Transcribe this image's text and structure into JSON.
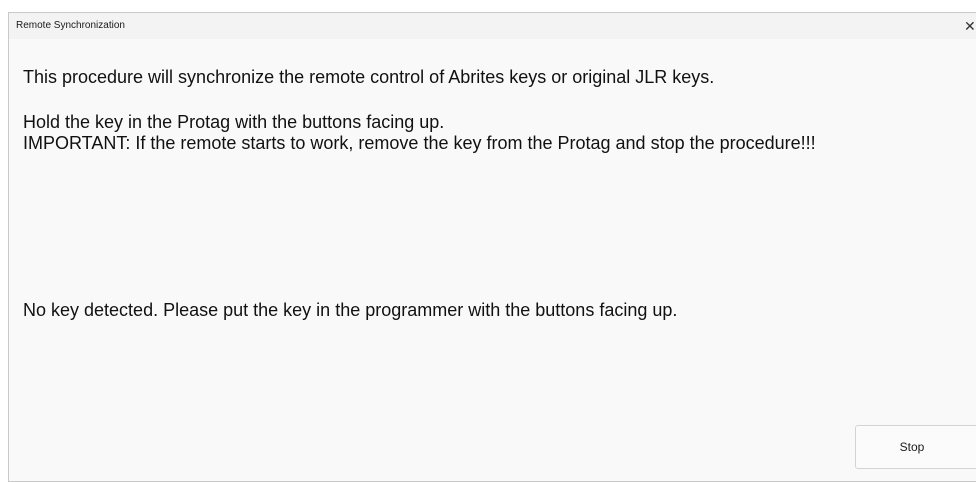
{
  "window": {
    "title": "Remote Synchronization",
    "close_glyph": "✕"
  },
  "content": {
    "intro": "This procedure will synchronize the remote control of Abrites keys or original JLR keys.",
    "instruction": "Hold the key in the Protag with the buttons facing up.",
    "warning": "IMPORTANT: If the remote starts to work, remove the key from the Protag and stop the procedure!!!",
    "status": "No key detected. Please put the key in the programmer with the buttons facing up."
  },
  "buttons": {
    "stop_label": "Stop"
  }
}
